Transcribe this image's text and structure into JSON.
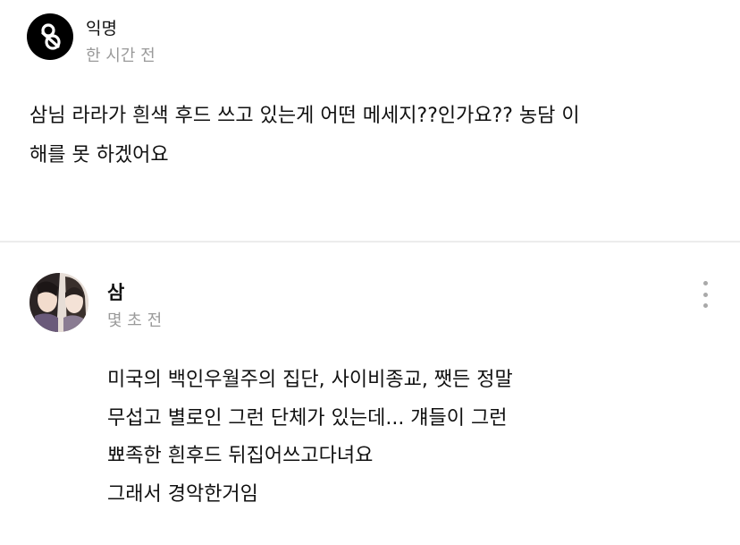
{
  "post": {
    "author": "익명",
    "time": "한 시간 전",
    "avatar_icon": "anonymous-logo-icon",
    "body_lines": [
      "삼님 라라가 흰색 후드 쓰고 있는게 어떤 메세지??인가요?? 농담 이",
      "해를 못 하겠어요"
    ]
  },
  "reply": {
    "author": "삼",
    "time": "몇 초 전",
    "more_icon": "more-vertical-icon",
    "body_lines": [
      "미국의 백인우월주의 집단, 사이비종교, 쨋든 정말",
      "무섭고 별로인 그런 단체가 있는데... 걔들이 그런",
      "뾰족한 흰후드 뒤집어쓰고다녀요",
      "그래서 경악한거임"
    ]
  },
  "colors": {
    "text": "#111111",
    "muted": "#9a9a9a",
    "divider": "#ececec",
    "anon_avatar_bg": "#000000"
  }
}
